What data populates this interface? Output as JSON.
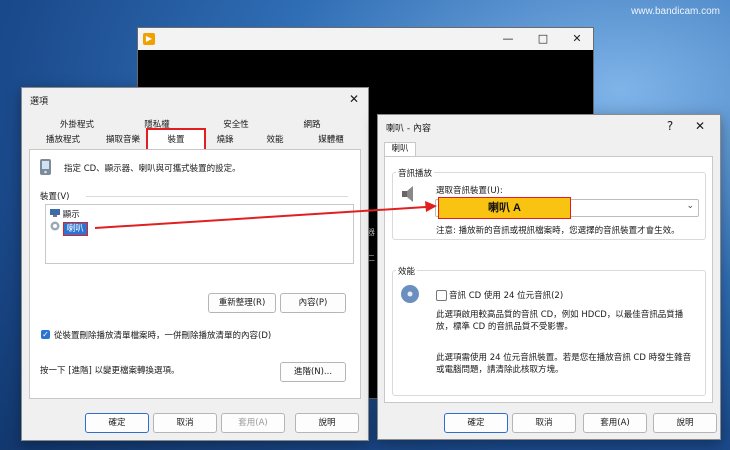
{
  "watermark": "www.bandicam.com",
  "player": {
    "controls": [
      "—",
      "□",
      "✕"
    ],
    "peek_text": [
      "器",
      "二"
    ]
  },
  "options": {
    "title": "選項",
    "close_glyph": "✕",
    "tabs_row1": [
      "外掛程式",
      "隱私權",
      "安全性",
      "網路"
    ],
    "tabs_row2": [
      "播放程式",
      "擷取音樂",
      "裝置",
      "燒錄",
      "效能",
      "媒體櫃"
    ],
    "description": "指定 CD、顯示器、喇叭與可攜式裝置的設定。",
    "devices_label": "裝置(V)",
    "devices": [
      "顯示",
      "喇叭"
    ],
    "reorder_button": "重新整理(R)",
    "properties_button": "內容(P)",
    "checkbox_label": "從裝置刪除播放清單檔案時，一併刪除播放清單的內容(D)",
    "advanced_text": "按一下 [進階] 以變更檔案轉換選項。",
    "advanced_button": "進階(N)...",
    "ok": "確定",
    "cancel": "取消",
    "apply": "套用(A)",
    "help": "說明"
  },
  "props": {
    "title": "喇叭 - 內容",
    "help_glyph": "?",
    "close_glyph": "✕",
    "tab": "喇叭",
    "audio_group": "音訊播放",
    "select_label": "選取音訊裝置(U):",
    "note": "注意: 播放新的音訊或視訊檔案時，您選擇的音訊裝置才會生效。",
    "perf_group": "效能",
    "cd_checkbox": "音訊 CD 使用 24 位元音訊(2)",
    "para1": "此選項啟用較高品質的音訊 CD，例如 HDCD，以最佳音訊品質播放，標準 CD 的音訊品質不受影響。",
    "para2": "此選項需使用 24 位元音訊裝置。若是您在播放音訊 CD 時發生雜音或電腦問題，請清除此核取方塊。",
    "ok": "確定",
    "cancel": "取消",
    "apply": "套用(A)",
    "help": "說明"
  },
  "annotation": {
    "label": "喇叭 A",
    "arrow_color": "#e02020",
    "box_color": "#f9c312"
  },
  "colors": {
    "accent": "#2b74d2",
    "highlight": "#e02020"
  }
}
